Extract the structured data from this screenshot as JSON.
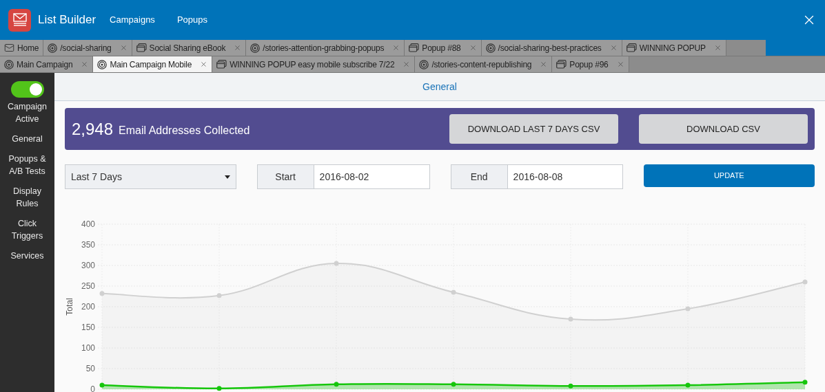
{
  "app": {
    "title": "List Builder",
    "nav": [
      "Campaigns",
      "Popups"
    ]
  },
  "tab_rows": [
    [
      {
        "label": "Home",
        "kind": "home",
        "closable": false,
        "selected": false
      },
      {
        "label": "/social-sharing",
        "kind": "target",
        "closable": true,
        "selected": false
      },
      {
        "label": "Social Sharing eBook",
        "kind": "popup",
        "closable": true,
        "selected": false
      },
      {
        "label": "/stories-attention-grabbing-popups",
        "kind": "target",
        "closable": true,
        "selected": false
      },
      {
        "label": "Popup #88",
        "kind": "popup",
        "closable": true,
        "selected": false
      },
      {
        "label": "/social-sharing-best-practices",
        "kind": "target",
        "closable": true,
        "selected": false
      },
      {
        "label": "WINNING POPUP",
        "kind": "popup",
        "closable": true,
        "selected": false
      }
    ],
    [
      {
        "label": "Main Campaign",
        "kind": "target",
        "closable": true,
        "selected": false
      },
      {
        "label": "Main Campaign Mobile",
        "kind": "target",
        "closable": true,
        "selected": true
      },
      {
        "label": "WINNING POPUP easy mobile subscribe 7/22",
        "kind": "popup",
        "closable": true,
        "selected": false
      },
      {
        "label": "/stories-content-republishing",
        "kind": "target",
        "closable": true,
        "selected": false
      },
      {
        "label": "Popup #96",
        "kind": "popup",
        "closable": true,
        "selected": false
      }
    ]
  ],
  "sidebar": {
    "toggle": {
      "on": true,
      "label": "Campaign Active"
    },
    "items": [
      "General",
      "Popups & A/B Tests",
      "Display Rules",
      "Click Triggers",
      "Services"
    ]
  },
  "section_title": "General",
  "banner": {
    "count": "2,948",
    "label": "Email Addresses Collected",
    "buttons": [
      "DOWNLOAD LAST 7 DAYS CSV",
      "DOWNLOAD CSV"
    ]
  },
  "filters": {
    "range": "Last 7 Days",
    "start_label": "Start",
    "start": "2016-08-02",
    "end_label": "End",
    "end": "2016-08-08",
    "update": "UPDATE"
  },
  "chart": {
    "chart_data": {
      "type": "area",
      "grid": true,
      "ylabel": "Total",
      "ylim": [
        0,
        400
      ],
      "yticks": [
        0,
        50,
        100,
        150,
        200,
        250,
        300,
        350,
        400
      ],
      "series": [
        {
          "color": "#d0d0d0",
          "values": [
            232,
            227,
            305,
            235,
            170,
            195,
            260
          ]
        },
        {
          "color": "#16c60c",
          "values": [
            10,
            2,
            12,
            12,
            8,
            10,
            17
          ]
        }
      ]
    }
  }
}
